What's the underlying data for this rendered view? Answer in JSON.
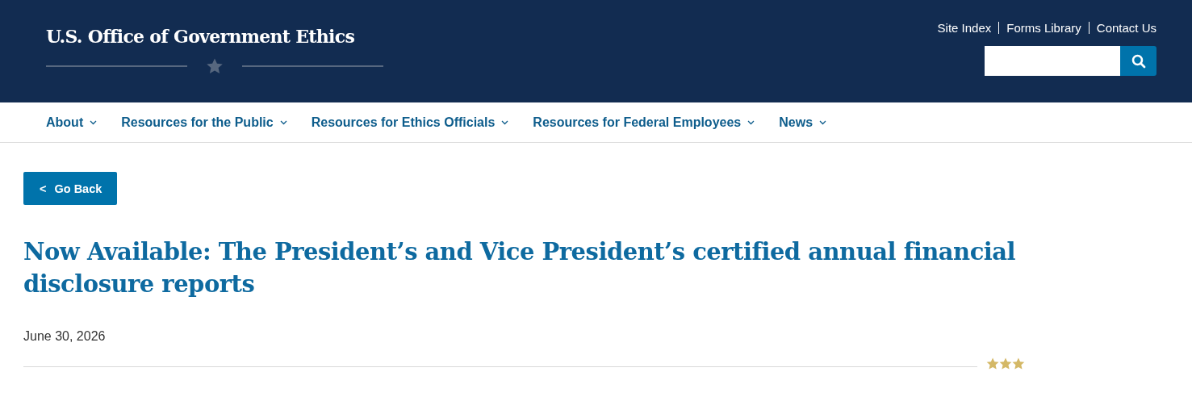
{
  "header": {
    "site_title": "U.S. Office of Government Ethics",
    "utility_links": [
      "Site Index",
      "Forms Library",
      "Contact Us"
    ]
  },
  "nav": [
    {
      "label": "About"
    },
    {
      "label": "Resources for the Public"
    },
    {
      "label": "Resources for Ethics Officials"
    },
    {
      "label": "Resources for Federal Employees"
    },
    {
      "label": "News"
    }
  ],
  "article": {
    "back_button": {
      "icon": "<",
      "label": "Go Back"
    },
    "title": "Now Available: The President’s and Vice President’s certified annual financial disclosure reports",
    "date": "June 30, 2026"
  }
}
